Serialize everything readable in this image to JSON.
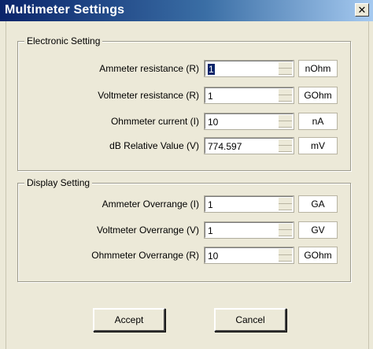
{
  "window": {
    "title": "Multimeter Settings",
    "close_glyph": "✕"
  },
  "electronic": {
    "legend": "Electronic Setting",
    "rows": [
      {
        "label": "Ammeter resistance (R)",
        "value": "1",
        "unit": "nOhm"
      },
      {
        "label": "Voltmeter resistance (R)",
        "value": "1",
        "unit": "GOhm"
      },
      {
        "label": "Ohmmeter current (I)",
        "value": "10",
        "unit": "nA"
      },
      {
        "label": "dB Relative Value (V)",
        "value": "774.597",
        "unit": "mV"
      }
    ]
  },
  "display": {
    "legend": "Display Setting",
    "rows": [
      {
        "label": "Ammeter Overrange (I)",
        "value": "1",
        "unit": "GA"
      },
      {
        "label": "Voltmeter Overrange (V)",
        "value": "1",
        "unit": "GV"
      },
      {
        "label": "Ohmmeter Overrange (R)",
        "value": "10",
        "unit": "GOhm"
      }
    ]
  },
  "buttons": {
    "accept": "Accept",
    "cancel": "Cancel"
  }
}
